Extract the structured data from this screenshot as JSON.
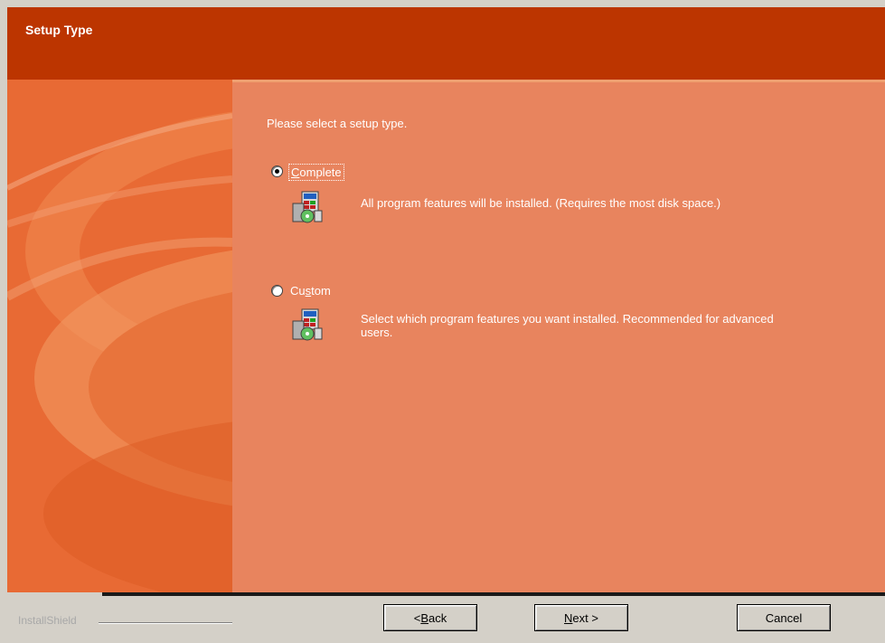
{
  "window": {
    "title": "Setup Type"
  },
  "main": {
    "prompt": "Please select a setup type.",
    "options": [
      {
        "label_pre": "",
        "label_u": "C",
        "label_post": "omplete",
        "selected": true,
        "description": "All program features will be installed. (Requires the most disk space.)"
      },
      {
        "label_pre": "Cu",
        "label_u": "s",
        "label_post": "tom",
        "selected": false,
        "description_line1": "Select which program features you want installed. Recommended for advanced",
        "description_line2": "users."
      }
    ]
  },
  "footer": {
    "brand": "InstallShield",
    "back_pre": "< ",
    "back_u": "B",
    "back_post": "ack",
    "next_u": "N",
    "next_post": "ext >",
    "cancel_label": "Cancel"
  },
  "colors": {
    "header": "#bc3500",
    "content": "#e8845e",
    "art": "#e86a34"
  }
}
